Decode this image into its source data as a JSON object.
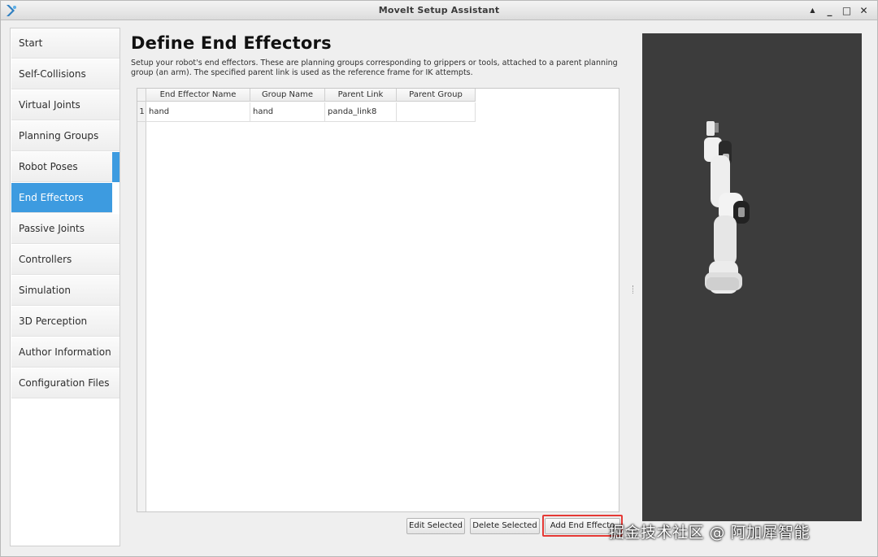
{
  "window": {
    "title": "MoveIt Setup Assistant",
    "controls": {
      "help": "▲",
      "minimize": "_",
      "maximize": "□",
      "close": "✕"
    }
  },
  "sidebar": {
    "items": [
      {
        "label": "Start"
      },
      {
        "label": "Self-Collisions"
      },
      {
        "label": "Virtual Joints"
      },
      {
        "label": "Planning Groups"
      },
      {
        "label": "Robot Poses"
      },
      {
        "label": "End Effectors"
      },
      {
        "label": "Passive Joints"
      },
      {
        "label": "Controllers"
      },
      {
        "label": "Simulation"
      },
      {
        "label": "3D Perception"
      },
      {
        "label": "Author Information"
      },
      {
        "label": "Configuration Files"
      }
    ],
    "active": "End Effectors"
  },
  "main": {
    "title": "Define End Effectors",
    "description": "Setup your robot's end effectors. These are planning groups corresponding to grippers or tools, attached to a parent planning group (an arm). The specified parent link is used as the reference frame for IK attempts.",
    "table": {
      "columns": [
        "End Effector Name",
        "Group Name",
        "Parent Link",
        "Parent Group"
      ],
      "rows": [
        {
          "num": "1",
          "cells": [
            "hand",
            "hand",
            "panda_link8",
            ""
          ]
        }
      ]
    },
    "buttons": {
      "edit": "Edit Selected",
      "delete": "Delete Selected",
      "add": "Add End Effecto"
    }
  },
  "viewer": {
    "background": "#3c3c3c"
  },
  "watermark": "掘金技术社区 @ 阿加犀智能",
  "colors": {
    "accent": "#3d9be0",
    "highlight": "#e53935"
  }
}
